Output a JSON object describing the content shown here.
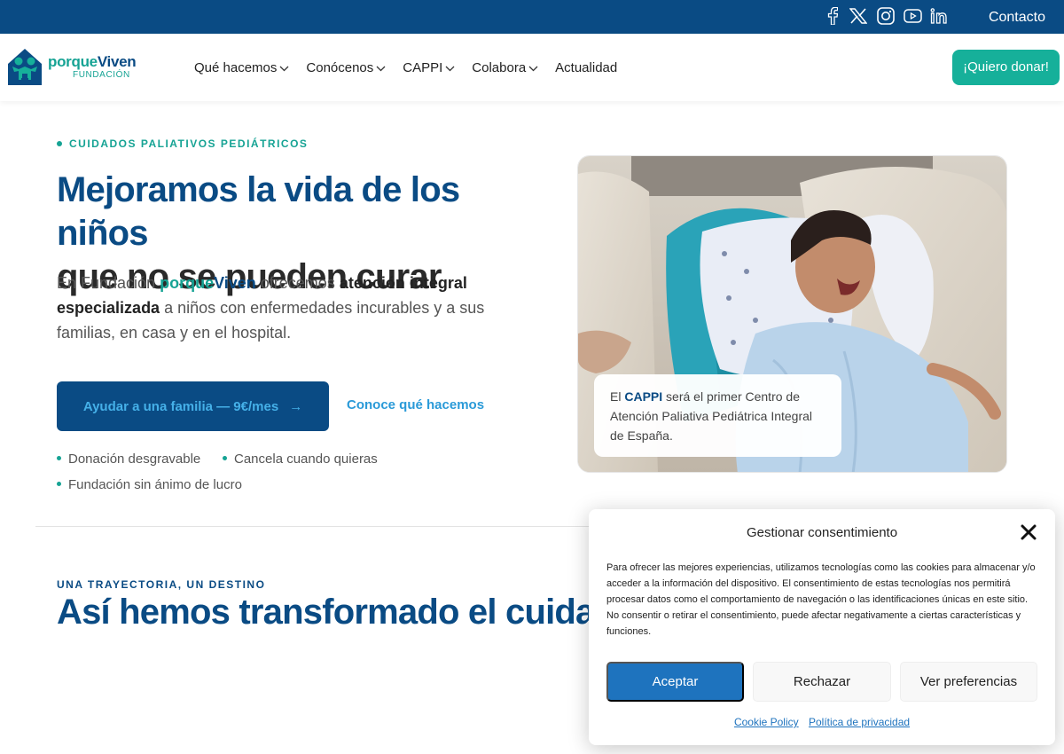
{
  "topbar": {
    "social": [
      "facebook-icon",
      "x-icon",
      "instagram-icon",
      "youtube-icon",
      "linkedin-icon"
    ],
    "contact_label": "Contacto"
  },
  "header": {
    "logo": {
      "brand_part1": "porque",
      "brand_part2": "Viven",
      "subtitle": "FUNDACIÓN"
    },
    "nav": [
      {
        "label": "Qué hacemos",
        "has_dropdown": true
      },
      {
        "label": "Conócenos",
        "has_dropdown": true
      },
      {
        "label": "CAPPI",
        "has_dropdown": true
      },
      {
        "label": "Colabora",
        "has_dropdown": true
      },
      {
        "label": "Actualidad",
        "has_dropdown": false
      }
    ],
    "donate_label": "¡Quiero donar!"
  },
  "hero": {
    "eyebrow": "CUIDADOS PALIATIVOS PEDIÁTRICOS",
    "title_line1": "Mejoramos la vida de los niños",
    "title_line2": "que no se pueden curar",
    "desc": {
      "p1": "En Fundación ",
      "brand1": "porque",
      "brand2": "Viven",
      "p2": " ofrecemos ",
      "bold1": "atención integral especializada",
      "p3": " a niños con enfermedades incurables y a sus familias, en casa y en el hospital."
    },
    "primary_cta": "Ayudar a una familia — 9€/mes",
    "primary_cta_arrow": "→",
    "secondary_cta": "Conoce qué hacemos",
    "bullets": [
      "Donación desgravable",
      "Cancela cuando quieras",
      "Fundación sin ánimo de lucro"
    ],
    "caption": {
      "p1": "El ",
      "bold": "CAPPI",
      "p2": " será el primer Centro de Atención Paliativa Pediátrica Integral de España."
    }
  },
  "section": {
    "eyebrow": "UNA TRAYECTORIA, UN DESTINO",
    "title": "Así hemos transformado el cuidado"
  },
  "consent": {
    "title": "Gestionar consentimiento",
    "text": "Para ofrecer las mejores experiencias, utilizamos tecnologías como las cookies para almacenar y/o acceder a la información del dispositivo. El consentimiento de estas tecnologías nos permitirá procesar datos como el comportamiento de navegación o las identificaciones únicas en este sitio. No consentir o retirar el consentimiento, puede afectar negativamente a ciertas características y funciones.",
    "accept": "Aceptar",
    "reject": "Rechazar",
    "preferences": "Ver preferencias",
    "link_cookie": "Cookie Policy",
    "link_privacy": "Política de privacidad"
  },
  "colors": {
    "navy": "#0a4b84",
    "teal": "#16a394",
    "donate": "#16b09a",
    "accept": "#1e73be"
  }
}
